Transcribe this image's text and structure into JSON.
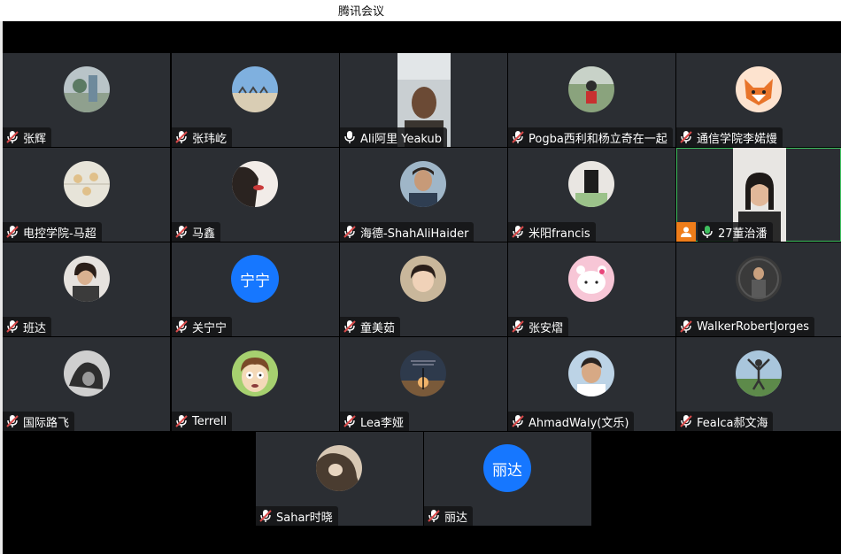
{
  "window": {
    "title": "腾讯会议"
  },
  "participants": [
    {
      "name": "张辉",
      "mic": "muted"
    },
    {
      "name": "张玮屹",
      "mic": "muted"
    },
    {
      "name": "Ali阿里 Yeakub",
      "mic": "on"
    },
    {
      "name": "Pogba西利和杨立奇在一起",
      "mic": "muted"
    },
    {
      "name": "通信学院李婼熳",
      "mic": "muted"
    },
    {
      "name": "电控学院-马超",
      "mic": "muted"
    },
    {
      "name": "马鑫",
      "mic": "muted"
    },
    {
      "name": "海德-ShahAliHaider",
      "mic": "muted"
    },
    {
      "name": "米阳francis",
      "mic": "muted"
    },
    {
      "name": "27董治潘",
      "mic": "on",
      "host": true,
      "speaking": true
    },
    {
      "name": "班达",
      "mic": "muted"
    },
    {
      "name": "关宁宁",
      "mic": "muted",
      "avatar_text": "宁宁"
    },
    {
      "name": "童美茹",
      "mic": "muted"
    },
    {
      "name": "张安熠",
      "mic": "muted"
    },
    {
      "name": "WalkerRobertJorges",
      "mic": "muted"
    },
    {
      "name": "国际路飞",
      "mic": "muted"
    },
    {
      "name": "Terrell",
      "mic": "muted"
    },
    {
      "name": "Lea李娅",
      "mic": "muted"
    },
    {
      "name": "AhmadWaly(文乐)",
      "mic": "muted"
    },
    {
      "name": "Fealca郝文海",
      "mic": "muted"
    },
    {
      "name": "Sahar时晓",
      "mic": "muted"
    },
    {
      "name": "丽达",
      "mic": "muted",
      "avatar_text": "丽达"
    }
  ],
  "colors": {
    "tile_bg": "#2b2e33",
    "text_avatar": "#1677ff",
    "host_badge": "#ef7d1a",
    "speaking_border": "#3fbf5f",
    "mic_muted": "#d84a4a"
  }
}
